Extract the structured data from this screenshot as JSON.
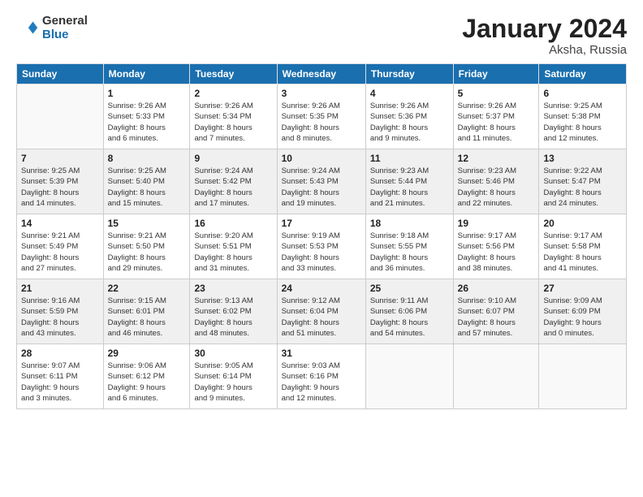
{
  "logo": {
    "general": "General",
    "blue": "Blue"
  },
  "header": {
    "title": "January 2024",
    "subtitle": "Aksha, Russia"
  },
  "columns": [
    "Sunday",
    "Monday",
    "Tuesday",
    "Wednesday",
    "Thursday",
    "Friday",
    "Saturday"
  ],
  "weeks": [
    [
      {
        "day": "",
        "info": ""
      },
      {
        "day": "1",
        "info": "Sunrise: 9:26 AM\nSunset: 5:33 PM\nDaylight: 8 hours\nand 6 minutes."
      },
      {
        "day": "2",
        "info": "Sunrise: 9:26 AM\nSunset: 5:34 PM\nDaylight: 8 hours\nand 7 minutes."
      },
      {
        "day": "3",
        "info": "Sunrise: 9:26 AM\nSunset: 5:35 PM\nDaylight: 8 hours\nand 8 minutes."
      },
      {
        "day": "4",
        "info": "Sunrise: 9:26 AM\nSunset: 5:36 PM\nDaylight: 8 hours\nand 9 minutes."
      },
      {
        "day": "5",
        "info": "Sunrise: 9:26 AM\nSunset: 5:37 PM\nDaylight: 8 hours\nand 11 minutes."
      },
      {
        "day": "6",
        "info": "Sunrise: 9:25 AM\nSunset: 5:38 PM\nDaylight: 8 hours\nand 12 minutes."
      }
    ],
    [
      {
        "day": "7",
        "info": "Sunrise: 9:25 AM\nSunset: 5:39 PM\nDaylight: 8 hours\nand 14 minutes."
      },
      {
        "day": "8",
        "info": "Sunrise: 9:25 AM\nSunset: 5:40 PM\nDaylight: 8 hours\nand 15 minutes."
      },
      {
        "day": "9",
        "info": "Sunrise: 9:24 AM\nSunset: 5:42 PM\nDaylight: 8 hours\nand 17 minutes."
      },
      {
        "day": "10",
        "info": "Sunrise: 9:24 AM\nSunset: 5:43 PM\nDaylight: 8 hours\nand 19 minutes."
      },
      {
        "day": "11",
        "info": "Sunrise: 9:23 AM\nSunset: 5:44 PM\nDaylight: 8 hours\nand 21 minutes."
      },
      {
        "day": "12",
        "info": "Sunrise: 9:23 AM\nSunset: 5:46 PM\nDaylight: 8 hours\nand 22 minutes."
      },
      {
        "day": "13",
        "info": "Sunrise: 9:22 AM\nSunset: 5:47 PM\nDaylight: 8 hours\nand 24 minutes."
      }
    ],
    [
      {
        "day": "14",
        "info": "Sunrise: 9:21 AM\nSunset: 5:49 PM\nDaylight: 8 hours\nand 27 minutes."
      },
      {
        "day": "15",
        "info": "Sunrise: 9:21 AM\nSunset: 5:50 PM\nDaylight: 8 hours\nand 29 minutes."
      },
      {
        "day": "16",
        "info": "Sunrise: 9:20 AM\nSunset: 5:51 PM\nDaylight: 8 hours\nand 31 minutes."
      },
      {
        "day": "17",
        "info": "Sunrise: 9:19 AM\nSunset: 5:53 PM\nDaylight: 8 hours\nand 33 minutes."
      },
      {
        "day": "18",
        "info": "Sunrise: 9:18 AM\nSunset: 5:55 PM\nDaylight: 8 hours\nand 36 minutes."
      },
      {
        "day": "19",
        "info": "Sunrise: 9:17 AM\nSunset: 5:56 PM\nDaylight: 8 hours\nand 38 minutes."
      },
      {
        "day": "20",
        "info": "Sunrise: 9:17 AM\nSunset: 5:58 PM\nDaylight: 8 hours\nand 41 minutes."
      }
    ],
    [
      {
        "day": "21",
        "info": "Sunrise: 9:16 AM\nSunset: 5:59 PM\nDaylight: 8 hours\nand 43 minutes."
      },
      {
        "day": "22",
        "info": "Sunrise: 9:15 AM\nSunset: 6:01 PM\nDaylight: 8 hours\nand 46 minutes."
      },
      {
        "day": "23",
        "info": "Sunrise: 9:13 AM\nSunset: 6:02 PM\nDaylight: 8 hours\nand 48 minutes."
      },
      {
        "day": "24",
        "info": "Sunrise: 9:12 AM\nSunset: 6:04 PM\nDaylight: 8 hours\nand 51 minutes."
      },
      {
        "day": "25",
        "info": "Sunrise: 9:11 AM\nSunset: 6:06 PM\nDaylight: 8 hours\nand 54 minutes."
      },
      {
        "day": "26",
        "info": "Sunrise: 9:10 AM\nSunset: 6:07 PM\nDaylight: 8 hours\nand 57 minutes."
      },
      {
        "day": "27",
        "info": "Sunrise: 9:09 AM\nSunset: 6:09 PM\nDaylight: 9 hours\nand 0 minutes."
      }
    ],
    [
      {
        "day": "28",
        "info": "Sunrise: 9:07 AM\nSunset: 6:11 PM\nDaylight: 9 hours\nand 3 minutes."
      },
      {
        "day": "29",
        "info": "Sunrise: 9:06 AM\nSunset: 6:12 PM\nDaylight: 9 hours\nand 6 minutes."
      },
      {
        "day": "30",
        "info": "Sunrise: 9:05 AM\nSunset: 6:14 PM\nDaylight: 9 hours\nand 9 minutes."
      },
      {
        "day": "31",
        "info": "Sunrise: 9:03 AM\nSunset: 6:16 PM\nDaylight: 9 hours\nand 12 minutes."
      },
      {
        "day": "",
        "info": ""
      },
      {
        "day": "",
        "info": ""
      },
      {
        "day": "",
        "info": ""
      }
    ]
  ]
}
